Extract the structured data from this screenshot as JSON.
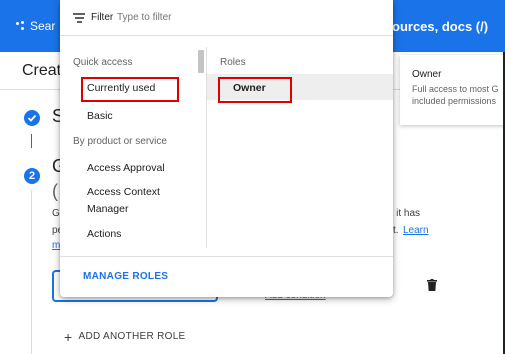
{
  "topbar": {
    "search_left": "Sear",
    "search_right": "ources, docs (/)"
  },
  "page": {
    "title": "Create"
  },
  "steps": {
    "step1_text": "S",
    "step2_number": "2",
    "step2_text": "G",
    "step2_sub": "("
  },
  "body_fragments": {
    "frag1": "Gi",
    "frag2": "pe",
    "frag3": "m",
    "frag4": "at it has",
    "frag5": "t.",
    "frag5_link": "Learn"
  },
  "role_row": {
    "condition_link": "Add condition"
  },
  "add_role": {
    "label": "ADD ANOTHER ROLE"
  },
  "owner_card": {
    "title": "Owner",
    "desc_line1": "Full access to most G",
    "desc_line2": "included permissions"
  },
  "dropdown": {
    "filter_label": "Filter",
    "filter_placeholder": "Type to filter",
    "quick_access_label": "Quick access",
    "quick_items": [
      "Currently used",
      "Basic"
    ],
    "by_product_label": "By product or service",
    "product_items": [
      "Access Approval",
      "Access Context",
      "Manager",
      "Actions"
    ],
    "roles_label": "Roles",
    "roles_items": [
      "Owner"
    ],
    "manage_roles": "MANAGE ROLES"
  },
  "colors": {
    "brand_blue": "#1a73e8",
    "highlight_red": "#e00000",
    "selected_row": "#eeeeee"
  },
  "icons": [
    "dots-icon",
    "check-icon",
    "filter-icon",
    "trash-icon",
    "plus-icon"
  ]
}
